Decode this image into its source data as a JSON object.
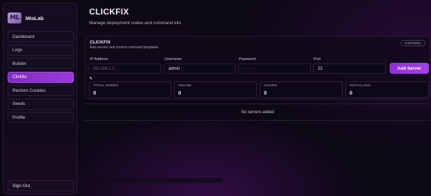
{
  "sidebar": {
    "brand": {
      "logo": "ML",
      "name": "MioLab"
    },
    "items": [
      {
        "label": "Dashboard",
        "active": false
      },
      {
        "label": "Logs",
        "active": false
      },
      {
        "label": "Builder",
        "active": false
      },
      {
        "label": "Clickfix",
        "active": true
      },
      {
        "label": "Restore Cookies",
        "active": false
      },
      {
        "label": "Seeds",
        "active": false
      },
      {
        "label": "Profile",
        "active": false
      }
    ],
    "signout": "Sign Out"
  },
  "page": {
    "title": "CLICKFIX",
    "subtitle": "Manage deployment nodes and command kits"
  },
  "panel": {
    "title": "CLICKFIX",
    "subtitle": "Add servers and control command templates",
    "badge": "CONTROL",
    "fields": [
      {
        "label": "IP Address",
        "value": "192.168.1.1",
        "is_placeholder": true
      },
      {
        "label": "Username",
        "value": "admin",
        "is_placeholder": false
      },
      {
        "label": "Password",
        "value": "········",
        "is_placeholder": true
      },
      {
        "label": "Port",
        "value": "22",
        "is_placeholder": false
      }
    ],
    "add_button": "Add Server",
    "stats": [
      {
        "label": "TOTAL NODES",
        "value": "0"
      },
      {
        "label": "ONLINE",
        "value": "0"
      },
      {
        "label": "ISSUES",
        "value": "0"
      },
      {
        "label": "INSTALLING",
        "value": "0"
      }
    ]
  },
  "empty_state": "No servers added",
  "colors": {
    "accent": "#9b3bd8",
    "background": "#0c0814"
  }
}
